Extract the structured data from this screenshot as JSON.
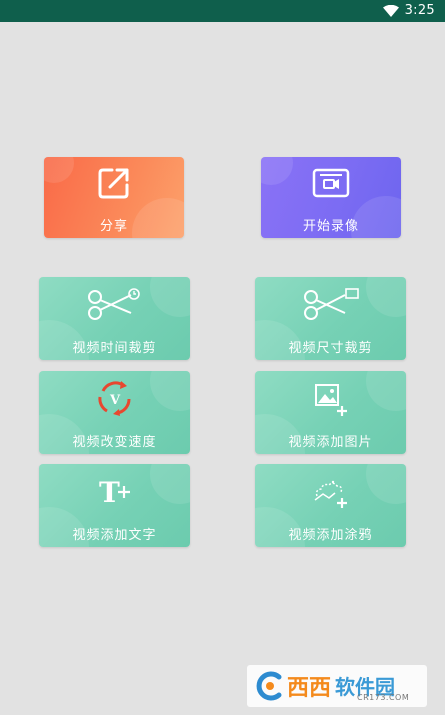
{
  "status_bar": {
    "time": "3:25"
  },
  "primary_actions": [
    {
      "label": "分享",
      "icon": "share-icon"
    },
    {
      "label": "开始录像",
      "icon": "video-record-icon"
    }
  ],
  "tools": [
    {
      "label": "视频时间裁剪",
      "icon": "scissors-clock-icon"
    },
    {
      "label": "视频尺寸裁剪",
      "icon": "scissors-frame-icon"
    },
    {
      "label": "视频改变速度",
      "icon": "speed-cycle-icon"
    },
    {
      "label": "视频添加图片",
      "icon": "add-image-icon"
    },
    {
      "label": "视频添加文字",
      "icon": "add-text-icon"
    },
    {
      "label": "视频添加涂鸦",
      "icon": "add-doodle-icon"
    }
  ],
  "watermark": {
    "brand": "西西",
    "brand2": "软件园",
    "site": "CR173.COM"
  },
  "colors": {
    "status_bar": "#0f5f4c",
    "share_card": "#f96a48",
    "record_card": "#7c6cf3",
    "tool_card": "#76d1b5",
    "background": "#e2e2e2"
  }
}
